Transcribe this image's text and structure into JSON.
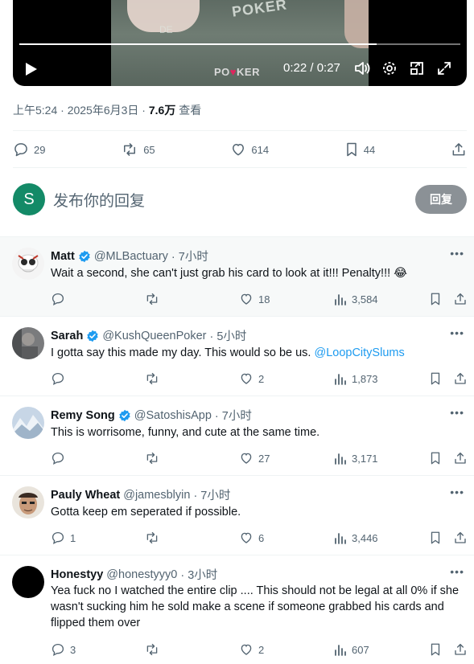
{
  "video": {
    "time_display": "0:22 / 0:27",
    "progress": 0.81,
    "watermark_prefix": "PO",
    "watermark_heart": "♥",
    "watermark_suffix": "KER",
    "felt_logo": "POKER",
    "felt_text": "DE"
  },
  "post_meta": {
    "time": "上午5:24",
    "date": "2025年6月3日",
    "views": "7.6万",
    "views_label": "查看"
  },
  "post_actions": {
    "replies": "29",
    "reposts": "65",
    "likes": "614",
    "bookmarks": "44"
  },
  "composer": {
    "avatar_letter": "S",
    "avatar_color": "#138a67",
    "placeholder": "发布你的回复",
    "button_label": "回复"
  },
  "replies": [
    {
      "name": "Matt",
      "verified": true,
      "handle": "@MLBactuary",
      "time": "· 7小时",
      "text": "Wait a second, she can't just grab his card to look at it!!! Penalty!!! 😂",
      "mention": "",
      "reply_count": "",
      "repost_count": "",
      "like_count": "18",
      "view_count": "3,584"
    },
    {
      "name": "Sarah",
      "verified": true,
      "handle": "@KushQueenPoker",
      "time": "· 5小时",
      "text": "I gotta say this made my day. This would so be us. ",
      "mention": "@LoopCitySlums",
      "reply_count": "",
      "repost_count": "",
      "like_count": "2",
      "view_count": "1,873"
    },
    {
      "name": "Remy Song",
      "verified": true,
      "handle": "@SatoshisApp",
      "time": "· 7小时",
      "text": "This is worrisome, funny, and cute at the same time.",
      "mention": "",
      "reply_count": "",
      "repost_count": "",
      "like_count": "27",
      "view_count": "3,171"
    },
    {
      "name": "Pauly Wheat",
      "verified": false,
      "handle": "@jamesblyin",
      "time": "· 7小时",
      "text": "Gotta keep em seperated if possible.",
      "mention": "",
      "reply_count": "1",
      "repost_count": "",
      "like_count": "6",
      "view_count": "3,446"
    },
    {
      "name": "Honestyy",
      "verified": false,
      "handle": "@honestyyy0",
      "time": "· 3小时",
      "text": "Yea fuck no I watched the entire clip .... This should not be legal at all 0% if she wasn't sucking him he sold make a scene if someone grabbed his cards and flipped them over",
      "mention": "",
      "reply_count": "3",
      "repost_count": "",
      "like_count": "2",
      "view_count": "607"
    }
  ],
  "colors": {
    "accent": "#1d9bf0",
    "muted": "#536471",
    "text": "#0f1419",
    "verified": "#1d9bf0"
  }
}
